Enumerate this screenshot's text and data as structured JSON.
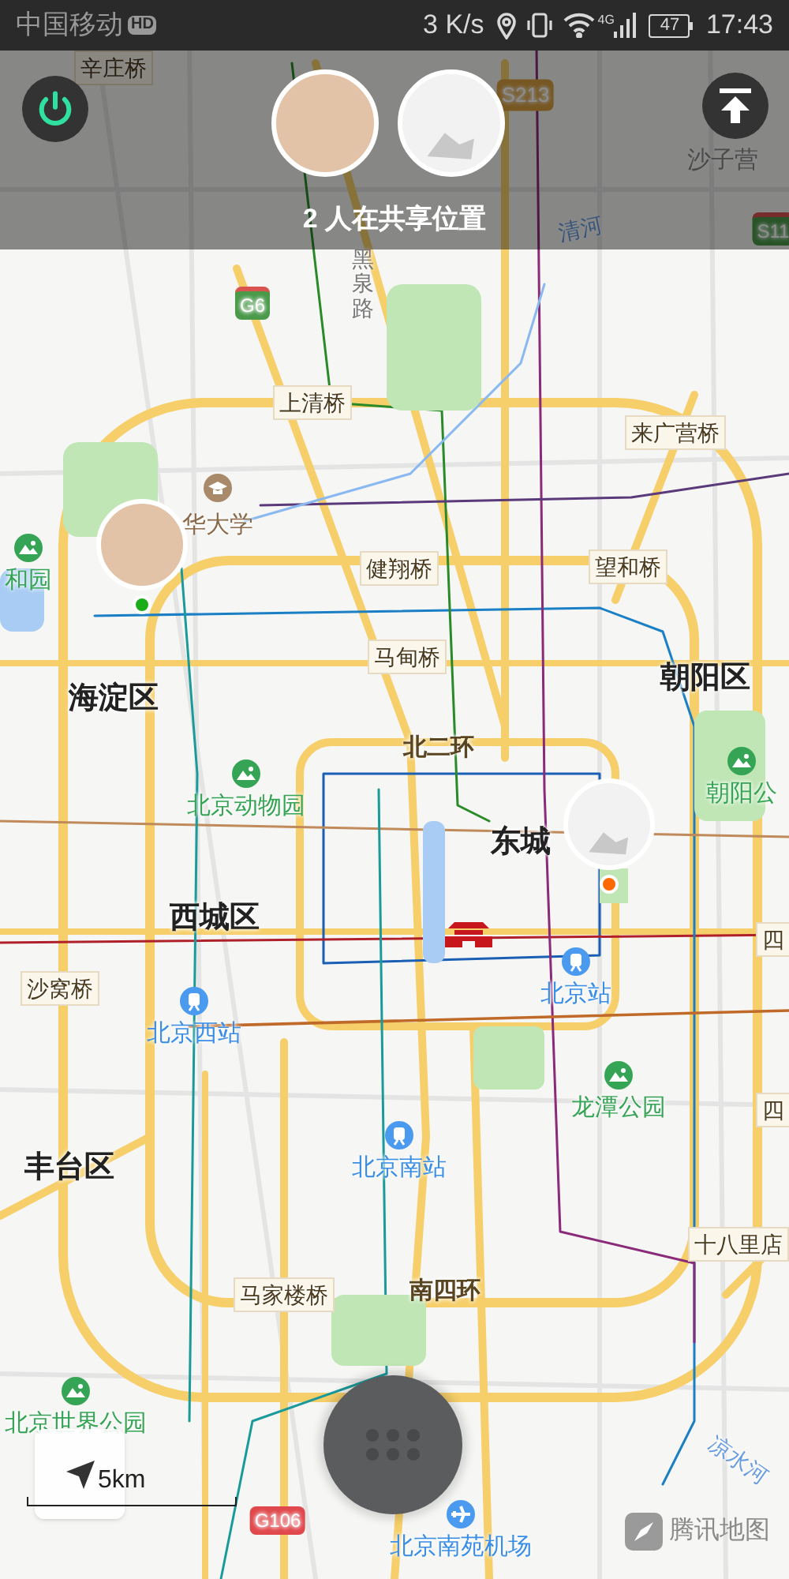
{
  "status_bar": {
    "carrier": "中国移动",
    "carrier_badge": "HD",
    "speed": "3 K/s",
    "network": "4G",
    "battery": "47",
    "time": "17:43"
  },
  "sharing": {
    "text": "2 人在共享位置",
    "avatars": [
      {
        "kind": "photo"
      },
      {
        "kind": "sketch"
      }
    ]
  },
  "map": {
    "labels": [
      {
        "text": "辛庄桥",
        "kind": "bridge"
      },
      {
        "text": "S213",
        "kind": "shield-yellow"
      },
      {
        "text": "沙子营",
        "kind": "plain"
      },
      {
        "text": "清河",
        "kind": "river"
      },
      {
        "text": "S11",
        "kind": "shield-green"
      },
      {
        "text": "G6",
        "kind": "shield-green"
      },
      {
        "text": "黑泉路",
        "kind": "vertical"
      },
      {
        "text": "上清桥",
        "kind": "bridge"
      },
      {
        "text": "来广营桥",
        "kind": "bridge"
      },
      {
        "text": "华大学",
        "kind": "university"
      },
      {
        "text": "和园",
        "kind": "park"
      },
      {
        "text": "健翔桥",
        "kind": "bridge"
      },
      {
        "text": "望和桥",
        "kind": "bridge"
      },
      {
        "text": "马甸桥",
        "kind": "bridge"
      },
      {
        "text": "朝阳区",
        "kind": "district"
      },
      {
        "text": "海淀区",
        "kind": "district"
      },
      {
        "text": "北二环",
        "kind": "road"
      },
      {
        "text": "朝阳公",
        "kind": "park"
      },
      {
        "text": "北京动物园",
        "kind": "park"
      },
      {
        "text": "东城",
        "kind": "district"
      },
      {
        "text": "西城区",
        "kind": "district"
      },
      {
        "text": "沙窝桥",
        "kind": "bridge"
      },
      {
        "text": "四",
        "kind": "bridge"
      },
      {
        "text": "北京站",
        "kind": "station"
      },
      {
        "text": "北京西站",
        "kind": "station"
      },
      {
        "text": "龙潭公园",
        "kind": "park"
      },
      {
        "text": "四",
        "kind": "bridge"
      },
      {
        "text": "丰台区",
        "kind": "district"
      },
      {
        "text": "北京南站",
        "kind": "station"
      },
      {
        "text": "十八里店",
        "kind": "bridge"
      },
      {
        "text": "马家楼桥",
        "kind": "bridge"
      },
      {
        "text": "南四环",
        "kind": "road"
      },
      {
        "text": "北京世界公园",
        "kind": "park"
      },
      {
        "text": "凉水河",
        "kind": "river"
      },
      {
        "text": "G106",
        "kind": "shield-red"
      },
      {
        "text": "北京南苑机场",
        "kind": "airport"
      }
    ],
    "pins": [
      {
        "kind": "photo",
        "color": "#1aad19"
      },
      {
        "kind": "sketch",
        "color": "#ff6a00"
      }
    ]
  },
  "scale": "5km",
  "logo": "腾讯地图"
}
